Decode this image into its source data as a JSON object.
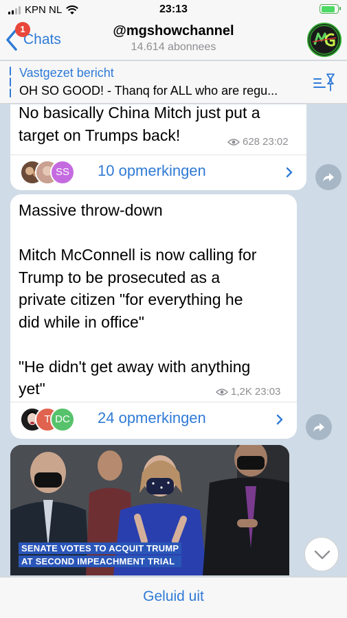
{
  "status_bar": {
    "carrier": "KPN NL",
    "time": "23:13",
    "signal_bars": 2,
    "battery_level": 0.9
  },
  "header": {
    "back_label": "Chats",
    "unread_badge": "1",
    "channel_name": "@mgshowchannel",
    "subscribers": "14.614 abonnees"
  },
  "pinned": {
    "title": "Vastgezet bericht",
    "text": "OH SO GOOD! - Thanq for ALL who are regu..."
  },
  "messages": [
    {
      "text": "No basically China Mitch just put a\ntarget on Trumps back!",
      "views": "628",
      "time": "23:02",
      "comments_label": "10 opmerkingen",
      "avatars": [
        "",
        "",
        "SS"
      ]
    },
    {
      "text": "Massive throw-down\n\nMitch McConnell is now calling for\nTrump to be prosecuted as a\nprivate citizen \"for everything he\ndid while in office\"\n\n\"He didn't get away with anything\nyet\"",
      "views": "1,2K",
      "time": "23:03",
      "comments_label": "24 opmerkingen",
      "avatars": [
        "",
        "T",
        "DC"
      ]
    }
  ],
  "photo": {
    "caption_line1": "SENATE VOTES TO ACQUIT TRUMP",
    "caption_line2": "AT SECOND IMPEACHMENT TRIAL"
  },
  "bottom": {
    "mute_label": "Geluid uit"
  },
  "colors": {
    "accent": "#2f7ad6",
    "badge": "#e8473a",
    "chat_background": "#cfdbe6"
  }
}
